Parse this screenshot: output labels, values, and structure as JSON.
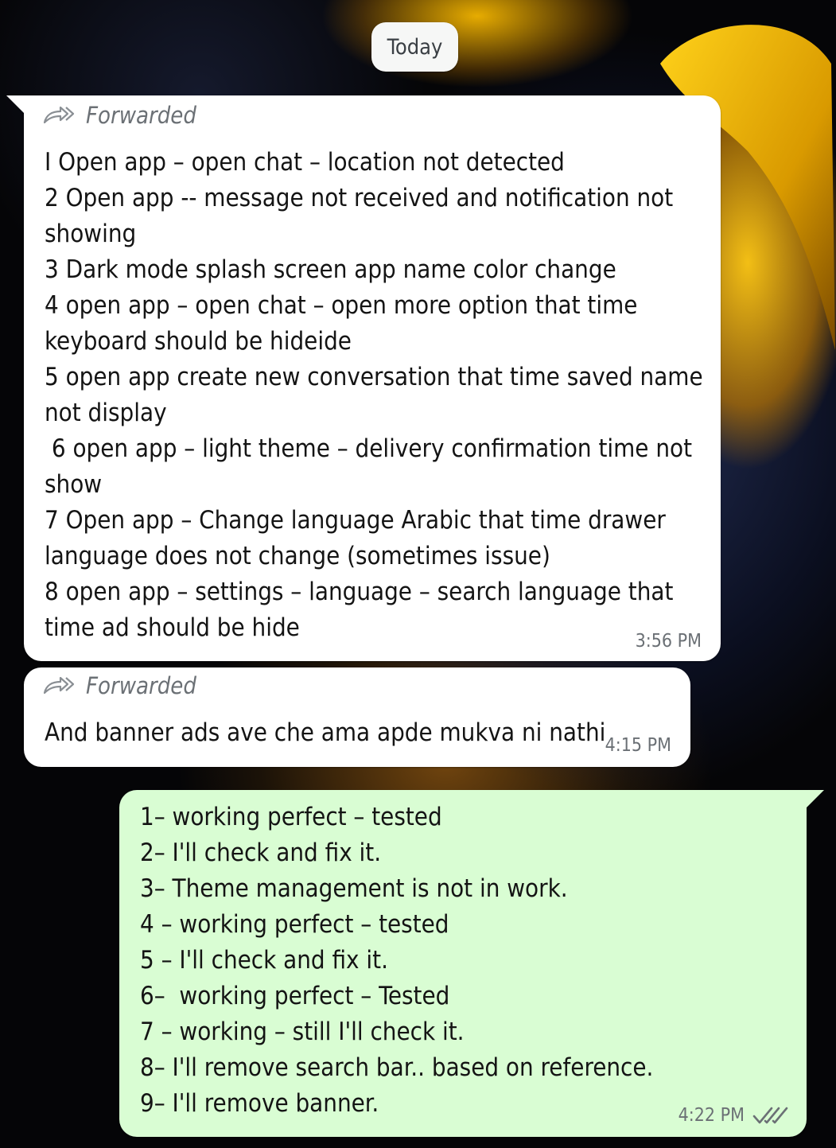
{
  "date_chip": "Today",
  "colors": {
    "incoming_bubble": "#ffffff",
    "outgoing_bubble": "#d9fdd3",
    "meta_text": "#6b7075",
    "tick_color": "#6b7075"
  },
  "messages": [
    {
      "direction": "incoming",
      "forwarded_label": "Forwarded",
      "forward_icon": "forward-arrow-icon",
      "lines": [
        "I Open app – open chat – location not detected",
        "2 Open app -- message not received and notification not",
        "showing",
        "3 Dark mode splash screen app name color change",
        "4 open app – open chat – open more option that time",
        "keyboard should be hideide",
        "5 open app create new conversation that time saved name",
        "not display",
        " 6 open app – light theme – delivery confirmation time not",
        "show",
        "7 Open app – Change language Arabic that time drawer",
        "language does not change (sometimes issue)",
        "8 open app – settings – language – search language that",
        "time ad should be hide"
      ],
      "time": "3:56 PM"
    },
    {
      "direction": "incoming",
      "forwarded_label": "Forwarded",
      "forward_icon": "forward-arrow-icon",
      "lines": [
        "And banner ads ave che ama apde mukva ni nathi"
      ],
      "time": "4:15 PM"
    },
    {
      "direction": "outgoing",
      "lines": [
        "1– working perfect – tested",
        "2– I'll check and fix it.",
        "3– Theme management is not in work.",
        "4 – working perfect – tested",
        "5 – I'll check and fix it.",
        "6–  working perfect – Tested",
        "7 – working – still I'll check it.",
        "8– I'll remove search bar.. based on reference.",
        "9– I'll remove banner."
      ],
      "time": "4:22 PM",
      "status_icon": "double-check-icon"
    }
  ]
}
